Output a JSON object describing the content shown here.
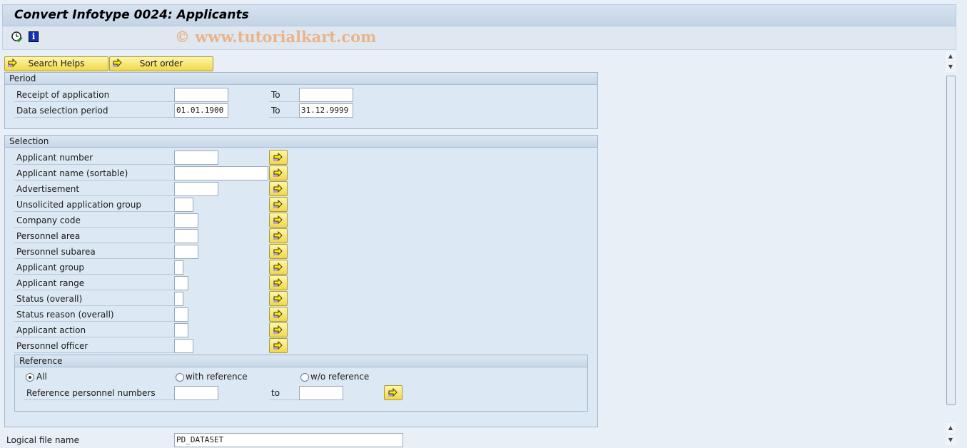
{
  "title": "Convert Infotype 0024: Applicants",
  "watermark": "© www.tutorialkart.com",
  "toolbar": {
    "execute_icon": "clock-check-icon",
    "info_icon": "info-icon"
  },
  "buttons": {
    "search_helps": "Search Helps",
    "sort_order": "Sort order"
  },
  "period": {
    "header": "Period",
    "rows": [
      {
        "label": "Receipt of application",
        "from": "",
        "to_label": "To",
        "to": ""
      },
      {
        "label": "Data selection period",
        "from": "01.01.1900",
        "to_label": "To",
        "to": "31.12.9999"
      }
    ]
  },
  "selection": {
    "header": "Selection",
    "rows": [
      {
        "label": "Applicant number",
        "value": ""
      },
      {
        "label": "Applicant name (sortable)",
        "value": ""
      },
      {
        "label": "Advertisement",
        "value": ""
      },
      {
        "label": "Unsolicited application group",
        "value": ""
      },
      {
        "label": "Company code",
        "value": ""
      },
      {
        "label": "Personnel area",
        "value": ""
      },
      {
        "label": "Personnel subarea",
        "value": ""
      },
      {
        "label": "Applicant group",
        "value": ""
      },
      {
        "label": "Applicant range",
        "value": ""
      },
      {
        "label": "Status (overall)",
        "value": ""
      },
      {
        "label": "Status reason (overall)",
        "value": ""
      },
      {
        "label": "Applicant action",
        "value": ""
      },
      {
        "label": "Personnel officer",
        "value": ""
      }
    ]
  },
  "reference": {
    "header": "Reference",
    "options": [
      {
        "label": "All",
        "selected": true
      },
      {
        "label": "with reference",
        "selected": false
      },
      {
        "label": "w/o reference",
        "selected": false
      }
    ],
    "pernr_label": "Reference personnel numbers",
    "pernr_from": "",
    "to_label": "to",
    "pernr_to": ""
  },
  "logical_file": {
    "label": "Logical file name",
    "value": "PD_DATASET"
  },
  "colors": {
    "button": "#f0d84a",
    "group_bg": "#dce8f3",
    "watermark": "#eab48a"
  }
}
